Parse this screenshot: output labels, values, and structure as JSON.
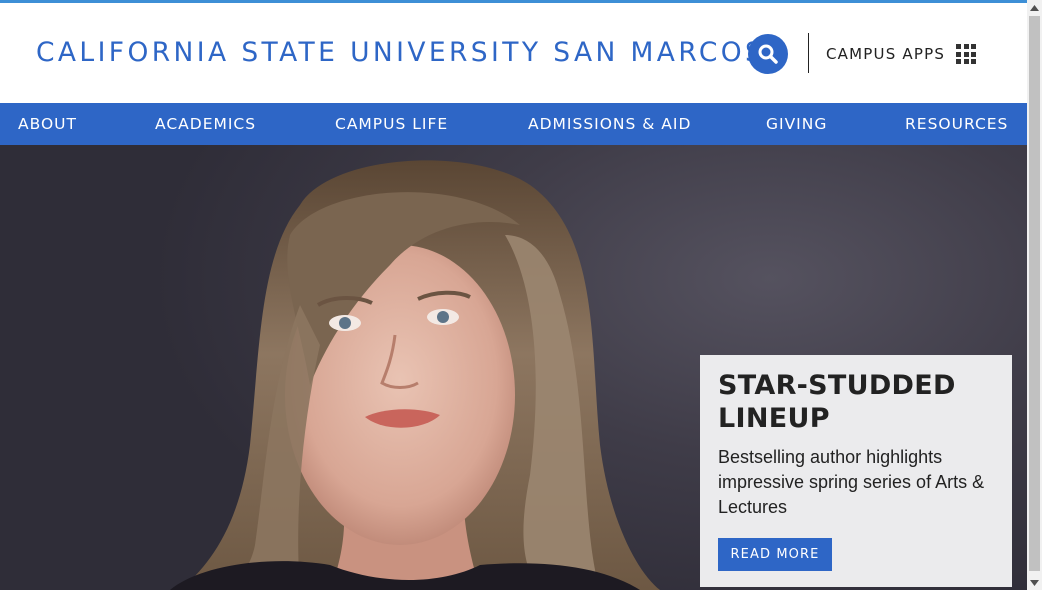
{
  "header": {
    "site_title": "CALIFORNIA STATE UNIVERSITY SAN MARCOS",
    "search_icon": "search-icon",
    "campus_apps_label": "CAMPUS APPS",
    "apps_icon": "grid-icon"
  },
  "nav": {
    "items": [
      {
        "label": "ABOUT"
      },
      {
        "label": "ACADEMICS"
      },
      {
        "label": "CAMPUS LIFE"
      },
      {
        "label": "ADMISSIONS & AID"
      },
      {
        "label": "GIVING"
      },
      {
        "label": "RESOURCES"
      }
    ]
  },
  "hero": {
    "title": "STAR-STUDDED LINEUP",
    "text": "Bestselling author highlights impressive spring series of Arts & Lectures",
    "button_label": "READ MORE"
  },
  "colors": {
    "brand_blue": "#2e66c6",
    "top_accent": "#3d8fd6",
    "caption_bg": "#ebebed"
  }
}
